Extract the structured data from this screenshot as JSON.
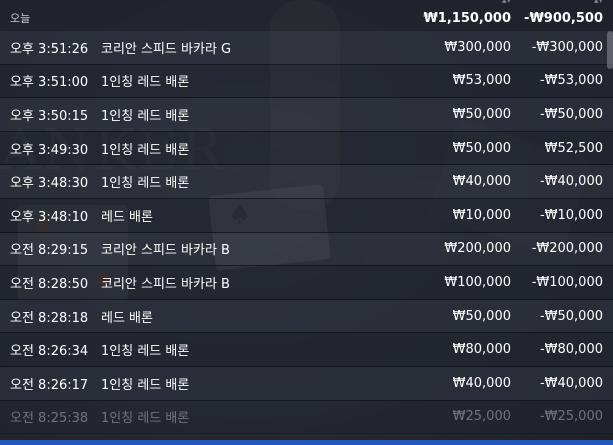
{
  "summary": {
    "label": "오늘",
    "total_bet": "₩1,150,000",
    "total_win": "-₩900,500"
  },
  "rows": [
    {
      "time": "오후 3:51:26",
      "game": "코리안 스피드 바카라 G",
      "bet": "₩300,000",
      "win": "-₩300,000"
    },
    {
      "time": "오후 3:51:00",
      "game": "1인칭 레드 배론",
      "bet": "₩53,000",
      "win": "-₩53,000"
    },
    {
      "time": "오후 3:50:15",
      "game": "1인칭 레드 배론",
      "bet": "₩50,000",
      "win": "-₩50,000"
    },
    {
      "time": "오후 3:49:30",
      "game": "1인칭 레드 배론",
      "bet": "₩50,000",
      "win": "₩52,500"
    },
    {
      "time": "오후 3:48:30",
      "game": "1인칭 레드 배론",
      "bet": "₩40,000",
      "win": "-₩40,000"
    },
    {
      "time": "오후 3:48:10",
      "game": "레드 배론",
      "bet": "₩10,000",
      "win": "-₩10,000"
    },
    {
      "time": "오전 8:29:15",
      "game": "코리안 스피드 바카라 B",
      "bet": "₩200,000",
      "win": "-₩200,000"
    },
    {
      "time": "오전 8:28:50",
      "game": "코리안 스피드 바카라 B",
      "bet": "₩100,000",
      "win": "-₩100,000"
    },
    {
      "time": "오전 8:28:18",
      "game": "레드 배론",
      "bet": "₩50,000",
      "win": "-₩50,000"
    },
    {
      "time": "오전 8:26:34",
      "game": "1인칭 레드 배론",
      "bet": "₩80,000",
      "win": "-₩80,000"
    },
    {
      "time": "오전 8:26:17",
      "game": "1인칭 레드 배론",
      "bet": "₩40,000",
      "win": "-₩40,000"
    },
    {
      "time": "오전 8:25:38",
      "game": "1인칭 레드 배론",
      "bet": "₩25,000",
      "win": "-₩25,000"
    }
  ],
  "colors": {
    "accent_bar": "#1f57c4",
    "text": "#ffffff"
  }
}
